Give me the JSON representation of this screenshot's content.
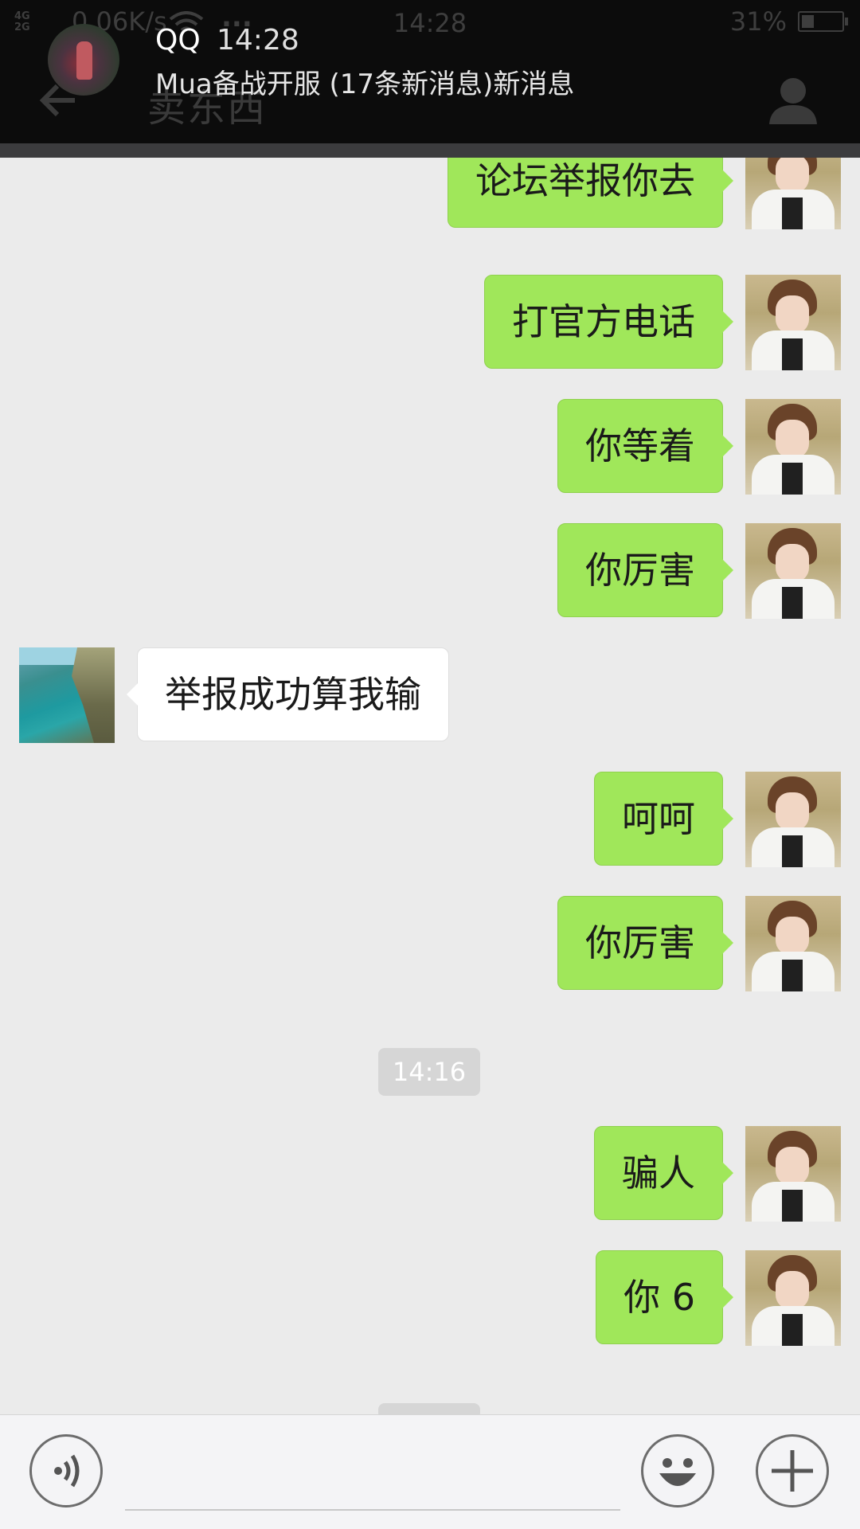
{
  "status_bar": {
    "network": "4G\n2G",
    "speed": "0.06K/s",
    "dots": "...",
    "time": "14:28",
    "battery_pct": "31%",
    "battery_level": 0.31
  },
  "header": {
    "title": "卖东西",
    "back_icon": "back-arrow-icon",
    "profile_icon": "person-icon"
  },
  "notification": {
    "app": "QQ",
    "time": "14:28",
    "text": "Mua备战开服 (17条新消息)新消息"
  },
  "messages": [
    {
      "side": "me",
      "text": "论坛举报你去"
    },
    {
      "side": "me",
      "text": "打官方电话"
    },
    {
      "side": "me",
      "text": "你等着"
    },
    {
      "side": "me",
      "text": "你厉害"
    },
    {
      "side": "other",
      "text": "举报成功算我输"
    },
    {
      "side": "me",
      "text": "呵呵"
    },
    {
      "side": "me",
      "text": "你厉害"
    },
    {
      "side": "time",
      "text": "14:16"
    },
    {
      "side": "me",
      "text": "骗人"
    },
    {
      "side": "me",
      "text": "你 6"
    }
  ],
  "input_bar": {
    "voice_icon": "voice-icon",
    "emoji_icon": "emoji-icon",
    "plus_icon": "plus-icon",
    "input_value": ""
  },
  "colors": {
    "my_bubble": "#a0e75a",
    "other_bubble": "#ffffff",
    "background": "#ebebeb",
    "header": "#0c0c0c"
  }
}
